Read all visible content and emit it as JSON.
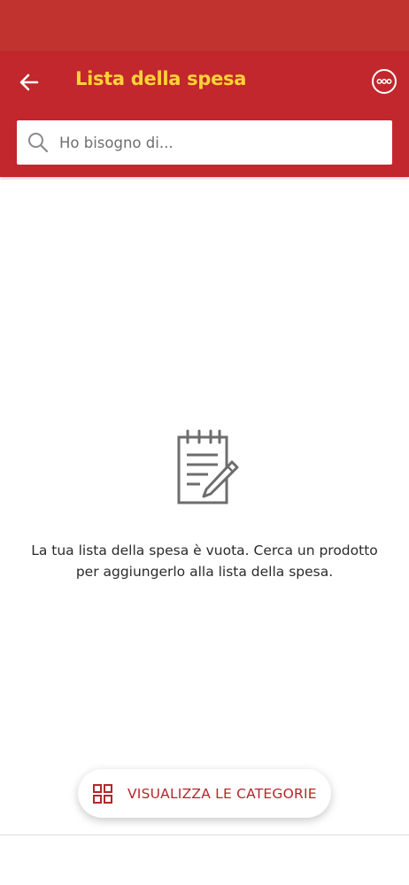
{
  "header": {
    "title": "Lista della spesa"
  },
  "search": {
    "placeholder": "Ho bisogno di..."
  },
  "empty_state": {
    "message": "La tua lista della spesa è vuota. Cerca un prodotto per aggiungerlo alla lista della spesa."
  },
  "categories_button": {
    "label": "VISUALIZZA LE CATEGORIE"
  },
  "icons": {
    "back": "arrow-left-icon",
    "more": "more-options-icon",
    "search": "search-icon",
    "empty": "notepad-pencil-icon",
    "categories": "grid-icon"
  },
  "colors": {
    "status_bar": "#c0332f",
    "app_bar": "#c1272d",
    "title": "#ffd335",
    "accent": "#b8252b"
  }
}
